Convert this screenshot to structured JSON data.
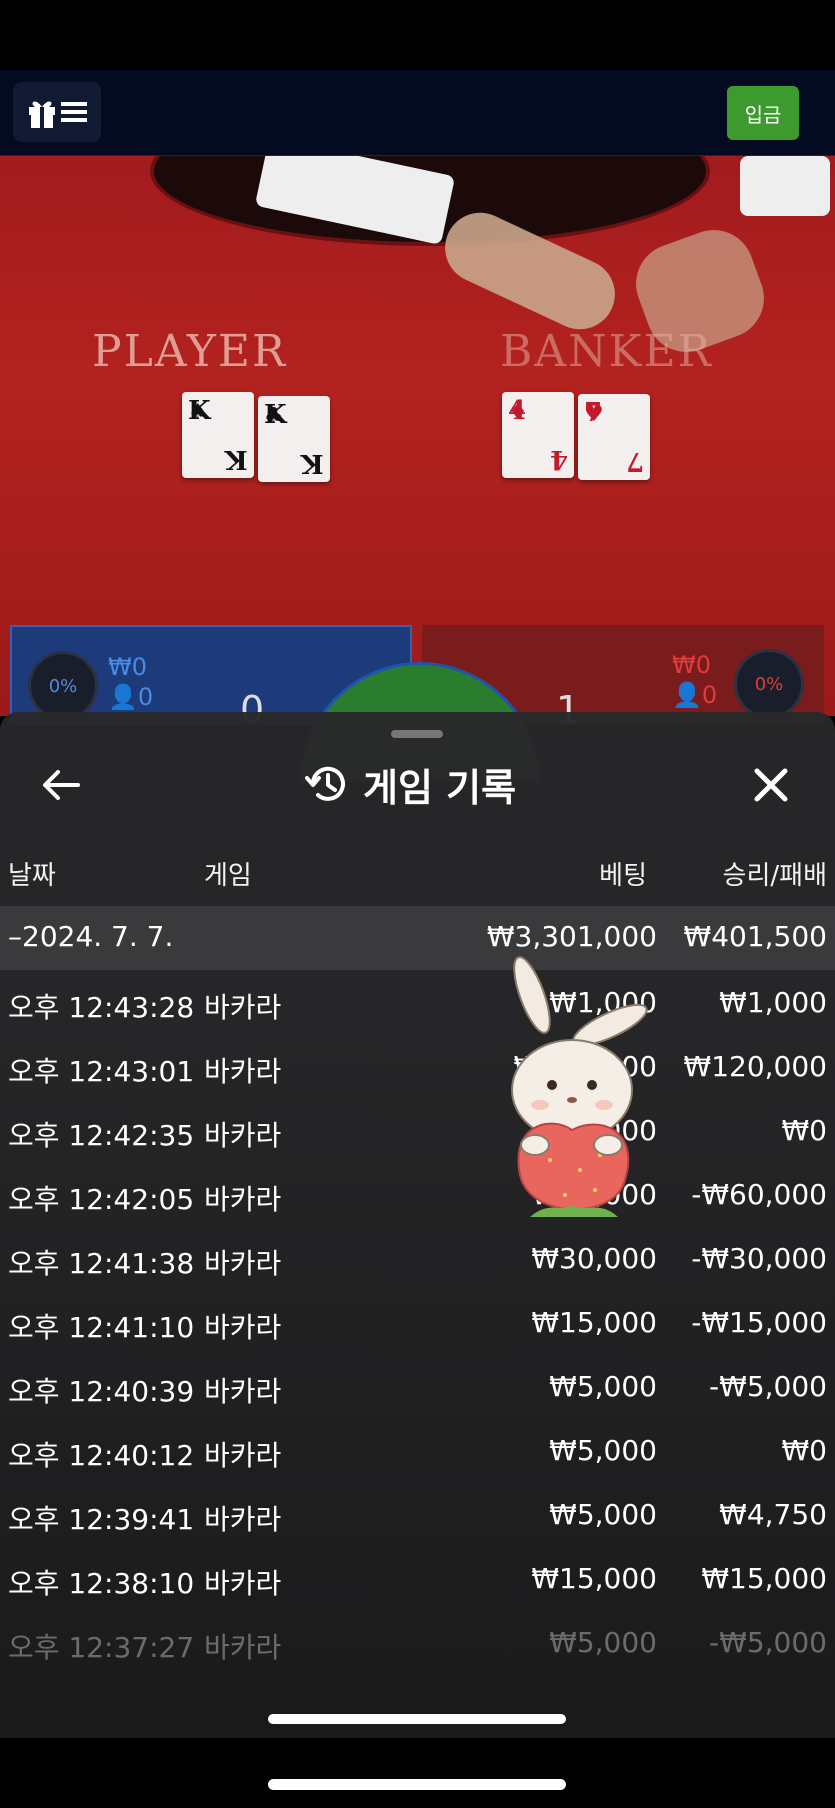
{
  "topbar": {
    "deposit_label": "입금"
  },
  "table": {
    "player_label": "PLAYER",
    "banker_label": "BANKER",
    "player_cards": [
      {
        "rank": "K",
        "suit": "♠"
      },
      {
        "rank": "K",
        "suit": "♣"
      }
    ],
    "banker_cards": [
      {
        "rank": "4",
        "suit": "♦"
      },
      {
        "rank": "7",
        "suit": "♥"
      }
    ],
    "player_pct": "0%",
    "player_amount": "₩0",
    "player_count": "0",
    "player_score": "0",
    "banker_pct": "0%",
    "banker_amount": "₩0",
    "banker_count": "0",
    "banker_score": "1"
  },
  "sheet": {
    "title": "게임 기록",
    "columns": {
      "date": "날짜",
      "game": "게임",
      "bet": "베팅",
      "winloss": "승리/패배"
    },
    "group": {
      "date": "–2024. 7. 7.",
      "bet_total": "₩3,301,000",
      "winloss_total": "₩401,500"
    },
    "rows": [
      {
        "time": "오후 12:43:28",
        "game": "바카라",
        "bet": "₩1,000",
        "winloss": "₩1,000"
      },
      {
        "time": "오후 12:43:01",
        "game": "바카라",
        "bet": "₩120,000",
        "winloss": "₩120,000"
      },
      {
        "time": "오후 12:42:35",
        "game": "바카라",
        "bet": "₩10,000",
        "winloss": "₩0"
      },
      {
        "time": "오후 12:42:05",
        "game": "바카라",
        "bet": "₩60,000",
        "winloss": "-₩60,000"
      },
      {
        "time": "오후 12:41:38",
        "game": "바카라",
        "bet": "₩30,000",
        "winloss": "-₩30,000"
      },
      {
        "time": "오후 12:41:10",
        "game": "바카라",
        "bet": "₩15,000",
        "winloss": "-₩15,000"
      },
      {
        "time": "오후 12:40:39",
        "game": "바카라",
        "bet": "₩5,000",
        "winloss": "-₩5,000"
      },
      {
        "time": "오후 12:40:12",
        "game": "바카라",
        "bet": "₩5,000",
        "winloss": "₩0"
      },
      {
        "time": "오후 12:39:41",
        "game": "바카라",
        "bet": "₩5,000",
        "winloss": "₩4,750"
      },
      {
        "time": "오후 12:38:10",
        "game": "바카라",
        "bet": "₩15,000",
        "winloss": "₩15,000"
      },
      {
        "time": "오후 12:37:27",
        "game": "바카라",
        "bet": "₩5,000",
        "winloss": "-₩5,000"
      }
    ]
  },
  "icons": {
    "menu": "gift-menu-icon",
    "back": "arrow-left-icon",
    "history": "history-clock-icon",
    "close": "close-icon",
    "sticker": "bunny-strawberry-sticker"
  },
  "colors": {
    "deposit": "#3d9a2f",
    "player": "#1d3a7a",
    "banker": "#7a1b1c",
    "sheet": "#262628"
  }
}
